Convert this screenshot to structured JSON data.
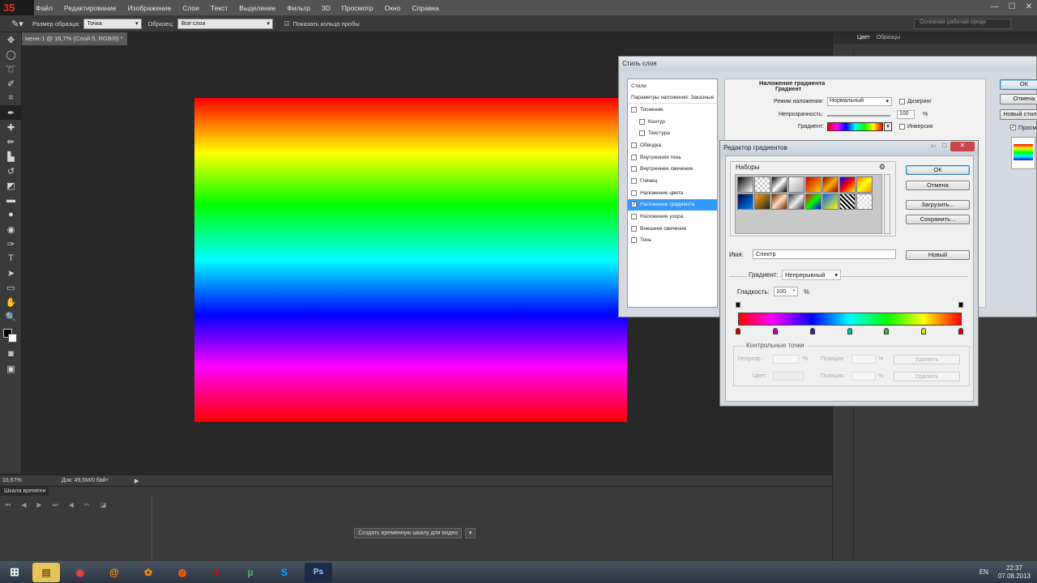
{
  "menu": {
    "logo": "35",
    "items": [
      "Файл",
      "Редактирование",
      "Изображение",
      "Слои",
      "Текст",
      "Выделение",
      "Фильтр",
      "3D",
      "Просмотр",
      "Окно",
      "Справка"
    ]
  },
  "options": {
    "sample_size_label": "Размер образца:",
    "sample_size_value": "Точка",
    "sample_label": "Образец:",
    "sample_value": "Все слои",
    "show_ring_label": "Показать кольцо пробы",
    "workspace": "Основная рабочая среда"
  },
  "document": {
    "tab_title": "мени-1 @ 16,7% (Слой 5, RGB/8) *",
    "zoom": "16,67%",
    "doc_size": "Док: 49,5M/0 байт"
  },
  "timeline": {
    "title": "Шкала времени",
    "create_button": "Создать временную шкалу для видео"
  },
  "panels": {
    "tab_color": "Цвет",
    "tab_swatches": "Образцы"
  },
  "layer_style": {
    "title": "Стиль слоя",
    "list": [
      {
        "label": "Стили",
        "check": false,
        "type": "header"
      },
      {
        "label": "Параметры наложения: Заказные",
        "check": false,
        "type": "header"
      },
      {
        "label": "Тиснение",
        "check": false,
        "type": "item"
      },
      {
        "label": "Контур",
        "check": false,
        "type": "sub"
      },
      {
        "label": "Текстура",
        "check": false,
        "type": "sub"
      },
      {
        "label": "Обводка",
        "check": false,
        "type": "item"
      },
      {
        "label": "Внутренняя тень",
        "check": false,
        "type": "item"
      },
      {
        "label": "Внутреннее свечение",
        "check": false,
        "type": "item"
      },
      {
        "label": "Глянец",
        "check": false,
        "type": "item"
      },
      {
        "label": "Наложение цвета",
        "check": false,
        "type": "item"
      },
      {
        "label": "Наложение градиента",
        "check": true,
        "type": "selected"
      },
      {
        "label": "Наложение узора",
        "check": false,
        "type": "item"
      },
      {
        "label": "Внешнее свечение",
        "check": false,
        "type": "item"
      },
      {
        "label": "Тень",
        "check": false,
        "type": "item"
      }
    ],
    "section_title": "Наложение градиента",
    "subsection": "Градиент",
    "blend_mode_label": "Режим наложения:",
    "blend_mode_value": "Нормальный",
    "dither_label": "Дизеринг",
    "opacity_label": "Непрозрачность:",
    "opacity_value": "100",
    "percent": "%",
    "gradient_label": "Градиент:",
    "invert_label": "Инверсия",
    "ok": "ОК",
    "cancel": "Отмена",
    "new_style": "Новый стиль...",
    "preview": "Просмотр"
  },
  "gradient_editor": {
    "title": "Редактор градиентов",
    "presets_label": "Наборы",
    "ok": "ОК",
    "cancel": "Отмена",
    "load": "Загрузить...",
    "save": "Сохранить...",
    "name_label": "Имя:",
    "name_value": "Спектр",
    "new_button": "Новый",
    "gradient_type_label": "Градиент:",
    "gradient_type_value": "Непрерывный",
    "smoothness_label": "Гладкость:",
    "smoothness_value": "100",
    "percent": "%",
    "stops_group": "Контрольные точки",
    "opacity_label": "Непрозр.:",
    "location_label": "Позиция:",
    "delete": "Удалить",
    "color_label": "Цвет:",
    "color_stops": [
      "#e00000",
      "#c000c0",
      "#1030c0",
      "#00c0c0",
      "#30c030",
      "#e0e000",
      "#e00000"
    ]
  },
  "taskbar": {
    "lang": "EN",
    "time": "22:37",
    "date": "07.08.2013"
  }
}
